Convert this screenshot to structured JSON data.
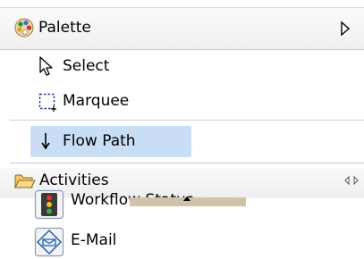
{
  "header": {
    "title": "Palette",
    "icon": "palette-icon",
    "collapse_icon": "collapse-arrow-icon"
  },
  "tools": [
    {
      "label": "Select",
      "icon": "arrow-cursor-icon"
    },
    {
      "label": "Marquee",
      "icon": "marquee-icon"
    },
    {
      "label": "Flow Path",
      "icon": "down-arrow-icon",
      "selected": true
    }
  ],
  "drawer": {
    "label": "Activities",
    "icon": "folder-open-icon",
    "resize_icon": "resize-arrows-icon",
    "entries": [
      {
        "label": "Workflow Status",
        "icon": "traffic-light-icon"
      },
      {
        "label": "E-Mail",
        "icon": "email-icon"
      }
    ]
  },
  "colors": {
    "selection": "#c9def5",
    "separator": "#d4d4d4",
    "tooltip_bar": "#cfc4a8"
  }
}
